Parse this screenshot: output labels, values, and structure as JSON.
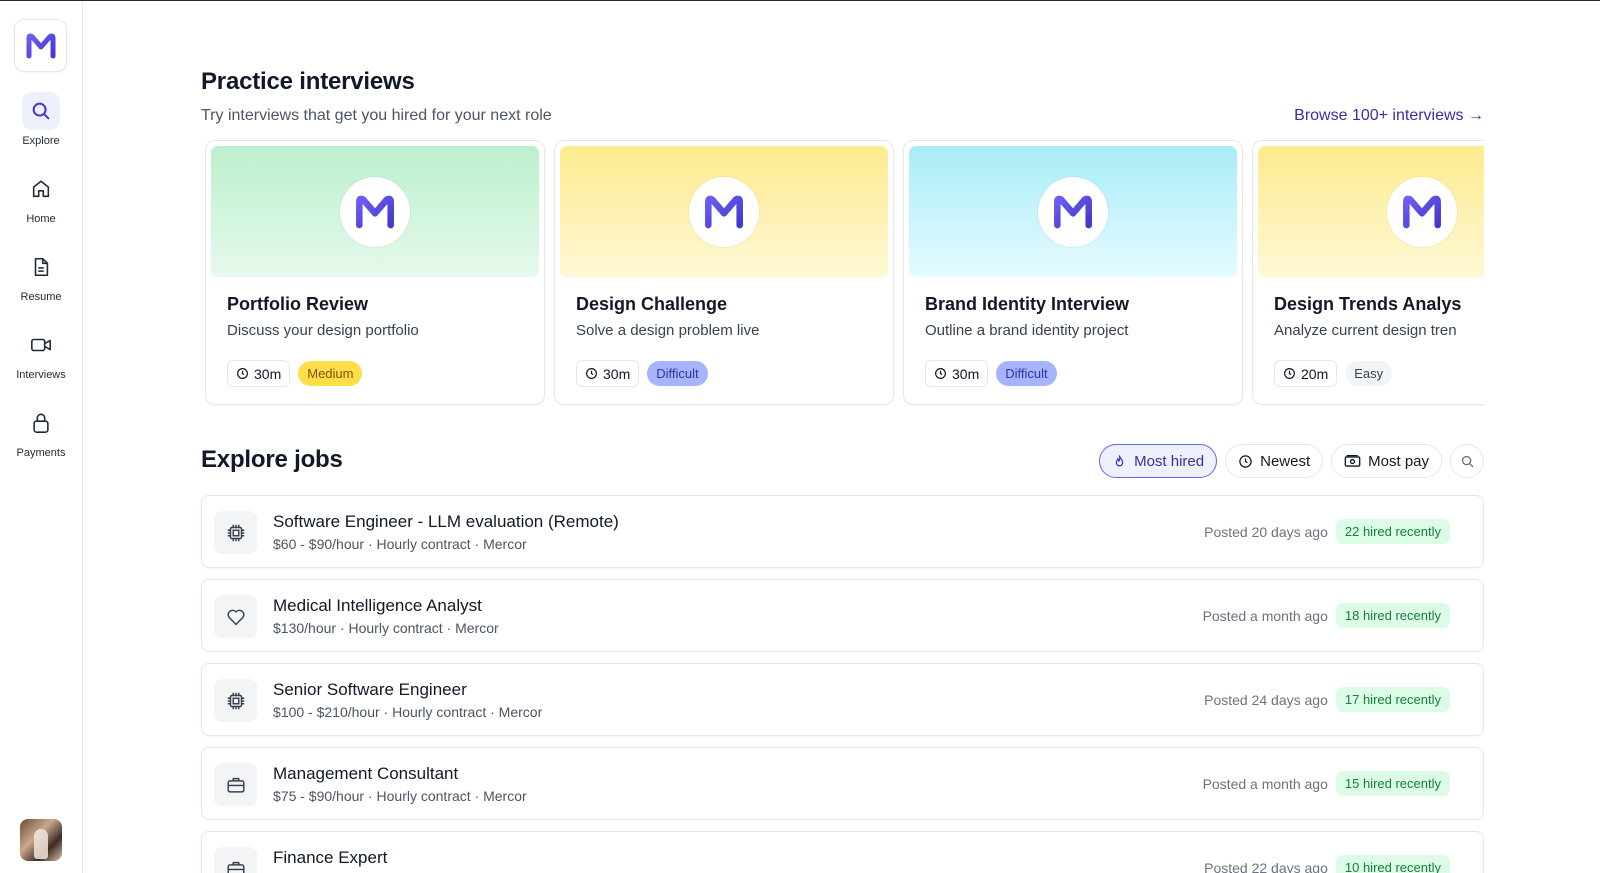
{
  "colors": {
    "accent": "#6366f1",
    "accent_text": "#3730a3",
    "medium_badge": "#fde047",
    "difficult_badge": "#a5b4fc",
    "hired_badge": "#dcfce7",
    "hired_text": "#15803d"
  },
  "brand": {
    "logo_letter": "M"
  },
  "sidebar": {
    "items": [
      {
        "label": "Explore",
        "icon": "search-icon",
        "active": true
      },
      {
        "label": "Home",
        "icon": "home-icon",
        "active": false
      },
      {
        "label": "Resume",
        "icon": "document-icon",
        "active": false
      },
      {
        "label": "Interviews",
        "icon": "video-icon",
        "active": false
      },
      {
        "label": "Payments",
        "icon": "lock-icon",
        "active": false
      }
    ]
  },
  "practice": {
    "title": "Practice interviews",
    "subtitle": "Try interviews that get you hired for your next role",
    "browse_link": "Browse 100+ interviews →",
    "cards": [
      {
        "title": "Portfolio Review",
        "description": "Discuss your design portfolio",
        "duration": "30m",
        "difficulty": "Medium",
        "banner": "green"
      },
      {
        "title": "Design Challenge",
        "description": "Solve a design problem live",
        "duration": "30m",
        "difficulty": "Difficult",
        "banner": "yellow"
      },
      {
        "title": "Brand Identity Interview",
        "description": "Outline a brand identity project",
        "duration": "30m",
        "difficulty": "Difficult",
        "banner": "cyan"
      },
      {
        "title": "Design Trends Analys",
        "description": "Analyze current design tren",
        "duration": "20m",
        "difficulty": "Easy",
        "banner": "yellow"
      }
    ]
  },
  "jobs": {
    "title": "Explore jobs",
    "filters": {
      "most_hired": "Most hired",
      "newest": "Newest",
      "most_pay": "Most pay"
    },
    "rows": [
      {
        "title": "Software Engineer - LLM evaluation (Remote)",
        "subtitle": "$60 - $90/hour · Hourly contract · Mercor",
        "posted": "Posted 20 days ago",
        "hired": "22 hired recently",
        "icon": "chip-icon"
      },
      {
        "title": "Medical Intelligence Analyst",
        "subtitle": "$130/hour · Hourly contract · Mercor",
        "posted": "Posted a month ago",
        "hired": "18 hired recently",
        "icon": "heart-icon"
      },
      {
        "title": "Senior Software Engineer",
        "subtitle": "$100 - $210/hour · Hourly contract · Mercor",
        "posted": "Posted 24 days ago",
        "hired": "17 hired recently",
        "icon": "chip-icon"
      },
      {
        "title": "Management Consultant",
        "subtitle": "$75 - $90/hour · Hourly contract · Mercor",
        "posted": "Posted a month ago",
        "hired": "15 hired recently",
        "icon": "briefcase-icon"
      },
      {
        "title": "Finance Expert",
        "subtitle": "",
        "posted": "Posted 22 days ago",
        "hired": "10 hired recently",
        "icon": "briefcase-icon"
      }
    ]
  }
}
